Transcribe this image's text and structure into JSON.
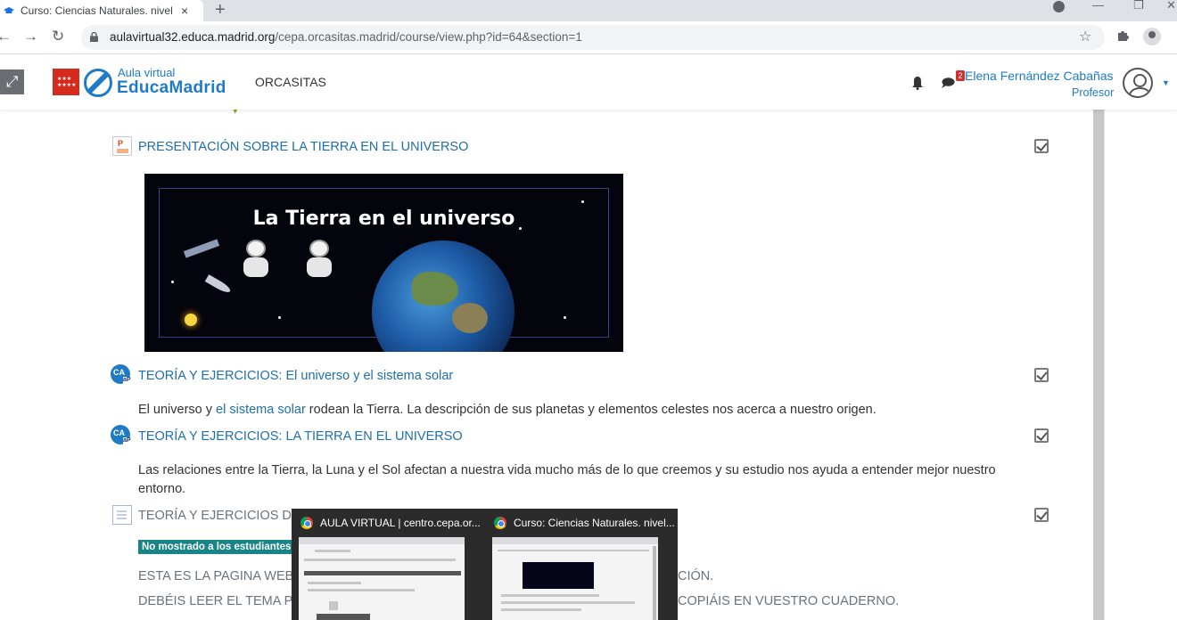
{
  "browser": {
    "tab_title": "Curso: Ciencias Naturales. nivel I",
    "tab_close": "×",
    "new_tab": "+",
    "url_host": "aulavirtual32.educa.madrid.org",
    "url_path": "/cepa.orcasitas.madrid/course/view.php?id=64&section=1",
    "minimize": "—",
    "restore": "❐",
    "close": "✕",
    "back": "←",
    "forward": "→",
    "reload": "↻",
    "star": "☆"
  },
  "header": {
    "expand_icon": "⤢",
    "logo_small": "Aula virtual",
    "logo_big": "EducaMadrid",
    "site_name": "ORCASITAS",
    "message_count": "2",
    "user_name": "Elena Fernández Cabañas",
    "user_role": "Profesor",
    "caret": "▼"
  },
  "activities": [
    {
      "title": "PRESENTACIÓN SOBRE LA TIERRA EN EL UNIVERSO",
      "icon": "powerpoint-icon"
    },
    {
      "title": "TEORÍA Y EJERCICIOS: El universo y el sistema solar",
      "icon": "cap-activity-icon",
      "desc_before": "El universo y ",
      "desc_link": "el sistema solar",
      "desc_after": " rodean la Tierra. La descripción de sus planetas y elementos celestes nos acerca a nuestro origen."
    },
    {
      "title": "TEORÍA Y EJERCICIOS: LA TIERRA EN EL UNIVERSO",
      "icon": "cap-activity-icon",
      "desc": "Las relaciones entre la Tierra, la Luna y el Sol afectan a nuestra vida mucho más de lo que creemos y su estudio nos ayuda a entender mejor nuestro entorno."
    },
    {
      "title": "TEORÍA Y EJERCICIOS DE L",
      "icon": "page-icon",
      "badge": "No mostrado a los estudiantes",
      "line1_left": "ESTA ES LA PAGINA WEB D",
      "line1_right": "CIÓN.",
      "line2_left": "DEBÉIS LEER EL TEMA PO",
      "line2_right": "COPIÁIS EN VUESTRO CUADERNO."
    }
  ],
  "banner": {
    "title": "La Tierra en el universo"
  },
  "taskbar_preview": [
    {
      "title": "AULA VIRTUAL | centro.cepa.or..."
    },
    {
      "title": "Curso: Ciencias Naturales. nivel..."
    }
  ],
  "colors": {
    "link": "#1f6fa8",
    "brand": "#1f7bc6",
    "badge": "#198488",
    "madrid_red": "#d52a1e"
  }
}
